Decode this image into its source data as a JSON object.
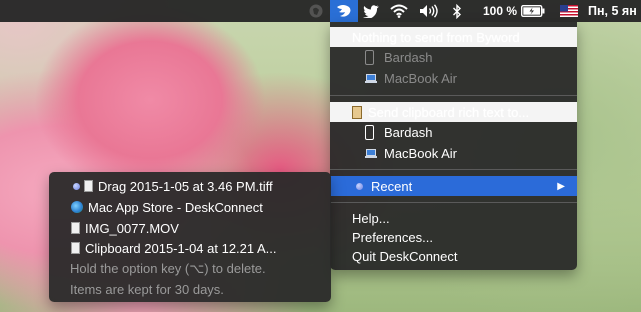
{
  "menubar": {
    "battery_text": "100 %",
    "clock": "Пн, 5 ян",
    "icons": [
      "evernote-icon",
      "deskconnect-icon",
      "twitter-icon",
      "wifi-icon",
      "volume-icon",
      "bluetooth-icon",
      "battery-icon",
      "flag-icon"
    ],
    "accent": "#2a6fd6"
  },
  "menu": {
    "section1_title": "Nothing to send from Byword",
    "section1_devices": [
      "Bardash",
      "MacBook Air"
    ],
    "section2_title": "Send clipboard rich text to...",
    "section2_devices": [
      "Bardash",
      "MacBook Air"
    ],
    "recent_label": "Recent",
    "help_label": "Help...",
    "preferences_label": "Preferences...",
    "quit_label": "Quit DeskConnect",
    "highlight_color": "#2b6bd9"
  },
  "recent": {
    "items": [
      "Drag 2015-1-05 at 3.46 PM.tiff",
      "Mac App Store - DeskConnect",
      "IMG_0077.MOV",
      "Clipboard 2015-1-04 at 12.21 A..."
    ],
    "hint_line1": "Hold the option key (⌥) to delete.",
    "hint_line2": "Items are kept for 30 days."
  }
}
